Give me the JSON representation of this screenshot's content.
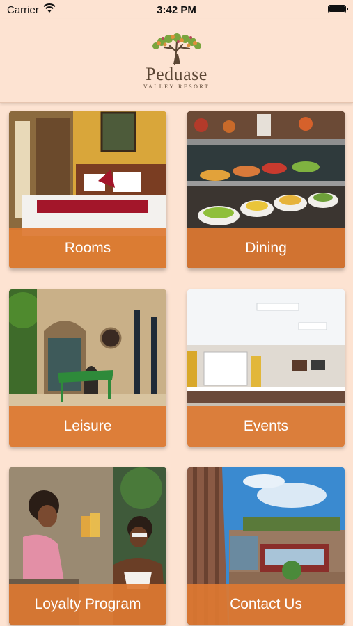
{
  "status_bar": {
    "carrier": "Carrier",
    "time": "3:42 PM",
    "wifi_icon": "wifi-icon",
    "battery_icon": "battery-icon"
  },
  "header": {
    "logo_name": "Peduase",
    "logo_subtitle": "VALLEY RESORT",
    "logo_icon": "tree-icon"
  },
  "menu": [
    {
      "label": "Rooms",
      "image": "hotel-bedroom-photo"
    },
    {
      "label": "Dining",
      "image": "buffet-food-photo"
    },
    {
      "label": "Leisure",
      "image": "ping-pong-courtyard-photo"
    },
    {
      "label": "Events",
      "image": "conference-room-photo"
    },
    {
      "label": "Loyalty Program",
      "image": "friends-toasting-photo"
    },
    {
      "label": "Contact Us",
      "image": "resort-building-photo"
    }
  ],
  "colors": {
    "background": "#fde3d2",
    "band": "#dd7831",
    "text_on_band": "#ffffff"
  }
}
